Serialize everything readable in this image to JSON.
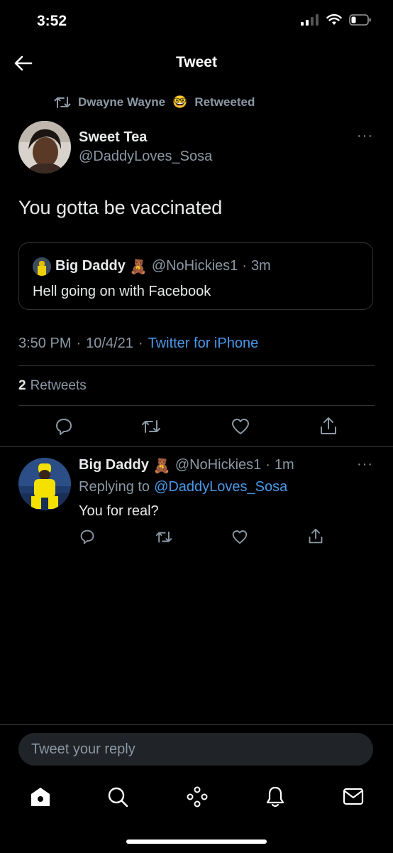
{
  "status": {
    "time": "3:52"
  },
  "header": {
    "title": "Tweet"
  },
  "retweet_context": {
    "name": "Dwayne Wayne",
    "emoji": "🤓",
    "label": "Retweeted"
  },
  "tweet": {
    "name": "Sweet Tea",
    "handle": "@DaddyLoves_Sosa",
    "text": "You gotta be vaccinated",
    "more": "···",
    "quoted": {
      "name": "Big Daddy",
      "emoji": "🧸",
      "handle": "@NoHickies1",
      "sep": "·",
      "age": "3m",
      "text": "Hell going on with Facebook"
    },
    "time": "3:50 PM",
    "dot1": "·",
    "date": "10/4/21",
    "dot2": "·",
    "source": "Twitter for iPhone",
    "retweets_count": "2",
    "retweets_label": "Retweets"
  },
  "reply": {
    "name": "Big Daddy",
    "emoji": "🧸",
    "handle": "@NoHickies1",
    "sep": "·",
    "age": "1m",
    "replying_label": "Replying to",
    "replying_to": "@DaddyLoves_Sosa",
    "text": "You for real?",
    "more": "···"
  },
  "composer": {
    "placeholder": "Tweet your reply"
  },
  "icons": {
    "back": "arrow-left-icon",
    "retweet": "retweet-icon",
    "reply": "reply-icon",
    "like": "heart-icon",
    "share": "share-icon",
    "home": "home-icon",
    "search": "search-icon",
    "spaces": "spaces-icon",
    "notifications": "bell-icon",
    "messages": "mail-icon"
  },
  "colors": {
    "background": "#000000",
    "accent": "#4a99e9",
    "muted": "#8b98a5"
  }
}
